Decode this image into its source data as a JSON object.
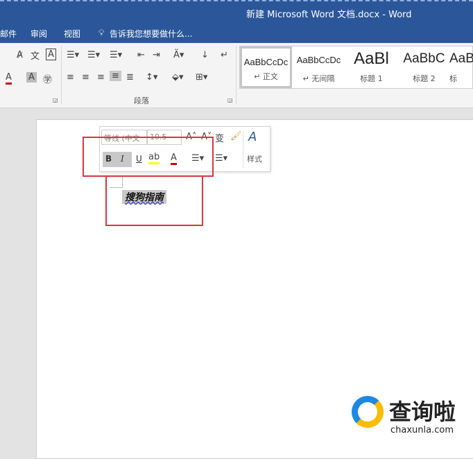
{
  "window": {
    "title": "新建 Microsoft Word 文档.docx - Word"
  },
  "tabs": [
    {
      "label": "邮件"
    },
    {
      "label": "审阅"
    },
    {
      "label": "视图"
    }
  ],
  "tell_me": "告诉我您想要做什么...",
  "groups": {
    "paragraph": "段落"
  },
  "styles": [
    {
      "preview": "AaBbCcDc",
      "name": "↵ 正文"
    },
    {
      "preview": "AaBbCcDc",
      "name": "↵ 无间隔"
    },
    {
      "preview": "AaBl",
      "name": "标题 1"
    },
    {
      "preview": "AaBbC",
      "name": "标题 2"
    },
    {
      "preview": "AaB",
      "name": "标"
    }
  ],
  "mini_toolbar": {
    "font": "等线 (中文",
    "size": "10.5",
    "bold": "B",
    "italic": "I",
    "underline": "U",
    "styles": "样式"
  },
  "document": {
    "selected_text": "搜狗指南"
  },
  "watermark": {
    "name": "查询啦",
    "url": "chaxunla.com"
  },
  "colors": {
    "accent": "#2b579a",
    "highlight": "#e53935"
  }
}
